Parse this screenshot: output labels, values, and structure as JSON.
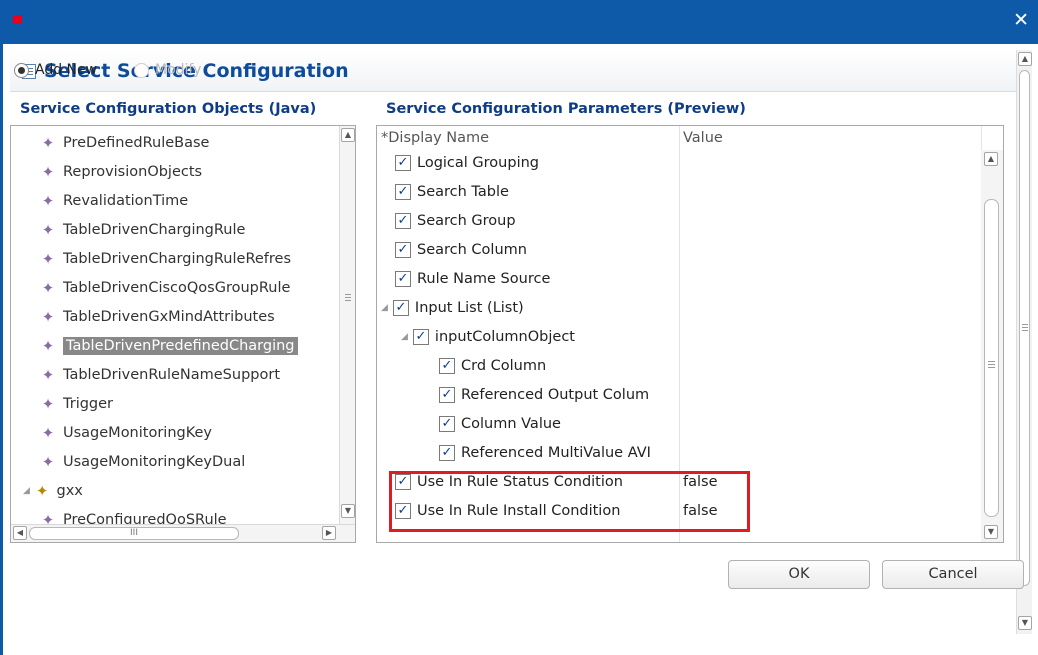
{
  "window": {
    "close_label": "✕"
  },
  "header": {
    "title": "Select Service Configuration"
  },
  "mode": {
    "add_new": "Add New",
    "modify": "Modify"
  },
  "objects_panel": {
    "title": "Service Configuration Objects (Java)",
    "items": [
      "PreDefinedRuleBase",
      "ReprovisionObjects",
      "RevalidationTime",
      "TableDrivenChargingRule",
      "TableDrivenChargingRuleRefres",
      "TableDrivenCiscoQosGroupRule",
      "TableDrivenGxMindAttributes",
      "TableDrivenPredefinedCharging",
      "TableDrivenRuleNameSupport",
      "Trigger",
      "UsageMonitoringKey",
      "UsageMonitoringKeyDual"
    ],
    "selected_index": 7,
    "package_label": "gxx",
    "package_child": "PreConfiguredQoSRule",
    "hscroll_grip": "III"
  },
  "params_panel": {
    "title": "Service Configuration Parameters (Preview)",
    "col_name": "*Display Name",
    "col_value": "Value",
    "rows": [
      {
        "name": "Logical Grouping",
        "value": "",
        "level": 0,
        "expand": false
      },
      {
        "name": "Search Table",
        "value": "",
        "level": 0,
        "expand": false
      },
      {
        "name": "Search Group",
        "value": "",
        "level": 0,
        "expand": false
      },
      {
        "name": "Search Column",
        "value": "",
        "level": 0,
        "expand": false
      },
      {
        "name": "Rule Name Source",
        "value": "",
        "level": 0,
        "expand": false
      },
      {
        "name": "Input List (List)",
        "value": "",
        "level": 0,
        "expand": true
      },
      {
        "name": "inputColumnObject",
        "value": "",
        "level": 1,
        "expand": true
      },
      {
        "name": "Crd Column",
        "value": "",
        "level": 2,
        "expand": false
      },
      {
        "name": "Referenced Output Colum",
        "value": "",
        "level": 2,
        "expand": false
      },
      {
        "name": "Column Value",
        "value": "",
        "level": 2,
        "expand": false
      },
      {
        "name": "Referenced MultiValue AVI",
        "value": "",
        "level": 2,
        "expand": false
      },
      {
        "name": "Use In Rule Status Condition",
        "value": "false",
        "level": 0,
        "expand": false
      },
      {
        "name": "Use In Rule Install Condition",
        "value": "false",
        "level": 0,
        "expand": false
      }
    ]
  },
  "buttons": {
    "ok": "OK",
    "cancel": "Cancel"
  }
}
